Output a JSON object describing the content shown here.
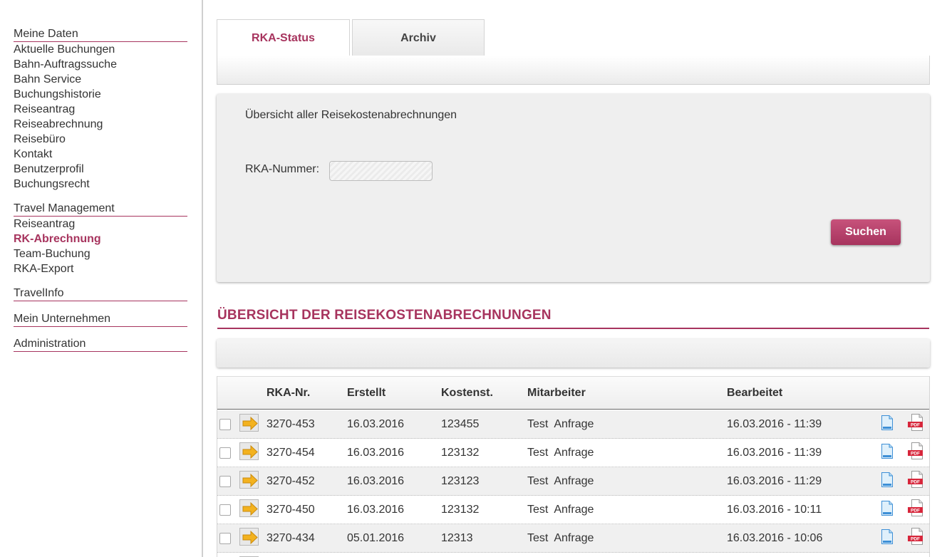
{
  "sidebar": {
    "sections": [
      {
        "title": "Meine Daten",
        "items": [
          "Aktuelle Buchungen",
          "Bahn-Auftragssuche",
          "Bahn Service",
          "Buchungshistorie",
          "Reiseantrag",
          "Reiseabrechnung",
          "Reisebüro",
          "Kontakt",
          "Benutzerprofil",
          "Buchungsrecht"
        ]
      },
      {
        "title": "Travel Management",
        "items": [
          "Reiseantrag",
          "RK-Abrechnung",
          "Team-Buchung",
          "RKA-Export"
        ],
        "active_item": "RK-Abrechnung"
      },
      {
        "title": "TravelInfo",
        "items": []
      },
      {
        "title": "Mein Unternehmen",
        "items": []
      },
      {
        "title": "Administration",
        "items": []
      }
    ]
  },
  "tabs": [
    {
      "label": "RKA-Status",
      "active": true
    },
    {
      "label": "Archiv",
      "active": false
    }
  ],
  "search": {
    "description": "Übersicht aller Reisekostenabrechnungen",
    "rka_label": "RKA-Nummer:",
    "rka_value": "",
    "button_label": "Suchen"
  },
  "overview": {
    "title": "ÜBERSICHT DER REISEKOSTENABRECHNUNGEN",
    "columns": [
      "RKA-Nr.",
      "Erstellt",
      "Kostenst.",
      "Mitarbeiter",
      "Bearbeitet"
    ],
    "rows": [
      {
        "rka_nr": "3270-453",
        "erstellt": "16.03.2016",
        "kostenst": "123455",
        "mitarbeiter": "Test  Anfrage",
        "bearbeitet": "16.03.2016 - 11:39"
      },
      {
        "rka_nr": "3270-454",
        "erstellt": "16.03.2016",
        "kostenst": "123132",
        "mitarbeiter": "Test  Anfrage",
        "bearbeitet": "16.03.2016 - 11:39"
      },
      {
        "rka_nr": "3270-452",
        "erstellt": "16.03.2016",
        "kostenst": "123123",
        "mitarbeiter": "Test  Anfrage",
        "bearbeitet": "16.03.2016 - 11:29"
      },
      {
        "rka_nr": "3270-450",
        "erstellt": "16.03.2016",
        "kostenst": "123132",
        "mitarbeiter": "Test  Anfrage",
        "bearbeitet": "16.03.2016 - 10:11"
      },
      {
        "rka_nr": "3270-434",
        "erstellt": "05.01.2016",
        "kostenst": "12313",
        "mitarbeiter": "Test  Anfrage",
        "bearbeitet": "16.03.2016 - 10:06"
      },
      {
        "rka_nr": "",
        "erstellt": "",
        "kostenst": "",
        "mitarbeiter": "",
        "bearbeitet": ""
      }
    ]
  },
  "icons": {
    "row_open": "arrow-right-icon",
    "row_document": "document-icon",
    "row_pdf": "pdf-icon"
  },
  "colors": {
    "accent": "#a7345e",
    "button": "#b94269",
    "panel": "#efefef",
    "row_alt": "#f0f0f0"
  }
}
